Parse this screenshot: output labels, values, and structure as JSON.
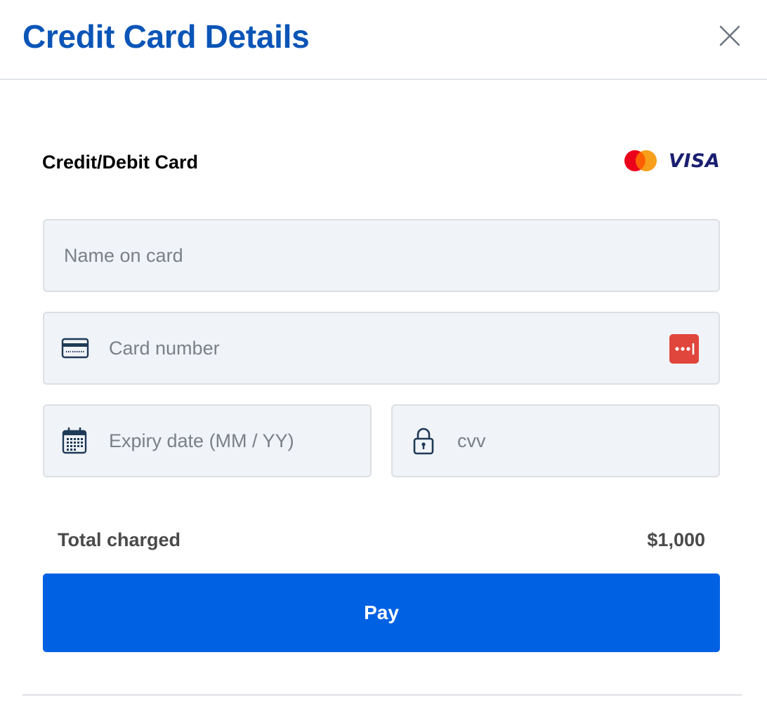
{
  "modal": {
    "title": "Credit Card Details",
    "close_icon": "close-icon"
  },
  "payment_method": {
    "label": "Credit/Debit Card",
    "brands": [
      "mastercard-logo",
      "visa-logo"
    ],
    "visa_text": "VISA"
  },
  "form": {
    "name_placeholder": "Name on card",
    "name_value": "",
    "card_number_placeholder": "Card number",
    "card_number_value": "",
    "card_number_icon": "credit-card-icon",
    "password_manager_icon": "password-manager-icon",
    "expiry_placeholder": "Expiry date (MM / YY)",
    "expiry_value": "",
    "expiry_icon": "calendar-icon",
    "cvv_placeholder": "cvv",
    "cvv_value": "",
    "cvv_icon": "lock-icon"
  },
  "summary": {
    "total_label": "Total charged",
    "total_value": "$1,000"
  },
  "actions": {
    "pay_label": "Pay"
  },
  "colors": {
    "title": "#0b55b7",
    "pay_button": "#0161e3",
    "field_bg": "#f0f3f7",
    "field_border": "#dcdfe4",
    "password_manager": "#e0463c",
    "mastercard_red": "#eb001b",
    "mastercard_orange": "#f79e1b",
    "visa_blue": "#1a1f71"
  }
}
